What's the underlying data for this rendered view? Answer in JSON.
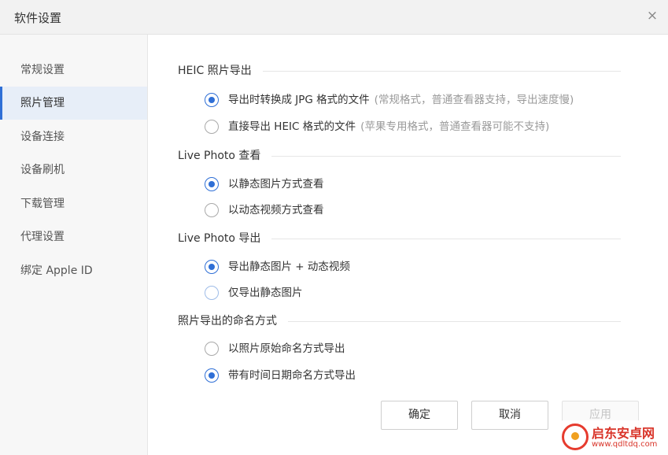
{
  "window": {
    "title": "软件设置",
    "close_icon": "close-icon",
    "close_glyph": "×"
  },
  "sidebar": {
    "items": [
      {
        "label": "常规设置",
        "active": false
      },
      {
        "label": "照片管理",
        "active": true
      },
      {
        "label": "设备连接",
        "active": false
      },
      {
        "label": "设备刷机",
        "active": false
      },
      {
        "label": "下载管理",
        "active": false
      },
      {
        "label": "代理设置",
        "active": false
      },
      {
        "label": "绑定 Apple ID",
        "active": false
      }
    ]
  },
  "sections": [
    {
      "title": "HEIC 照片导出",
      "options": [
        {
          "label": "导出时转换成 JPG 格式的文件",
          "hint": "(常规格式，普通查看器支持，导出速度慢)",
          "checked": true
        },
        {
          "label": "直接导出 HEIC 格式的文件",
          "hint": "(苹果专用格式，普通查看器可能不支持)",
          "checked": false
        }
      ]
    },
    {
      "title": "Live Photo 查看",
      "options": [
        {
          "label": "以静态图片方式查看",
          "checked": true
        },
        {
          "label": "以动态视频方式查看",
          "checked": false
        }
      ]
    },
    {
      "title": "Live Photo 导出",
      "options": [
        {
          "label": "导出静态图片 + 动态视频",
          "checked": true
        },
        {
          "label": "仅导出静态图片",
          "checked": false
        }
      ]
    },
    {
      "title": "照片导出的命名方式",
      "options": [
        {
          "label": "以照片原始命名方式导出",
          "checked": false
        },
        {
          "label": "带有时间日期命名方式导出",
          "checked": true
        }
      ]
    }
  ],
  "buttons": {
    "confirm": "确定",
    "cancel": "取消",
    "apply": "应用"
  },
  "watermark": {
    "title": "启东安卓网",
    "url": "www.qdltdq.com"
  },
  "colors": {
    "accent": "#2f6fd6",
    "sidebar_active_bg": "#e7eef8",
    "watermark": "#d9352a"
  }
}
